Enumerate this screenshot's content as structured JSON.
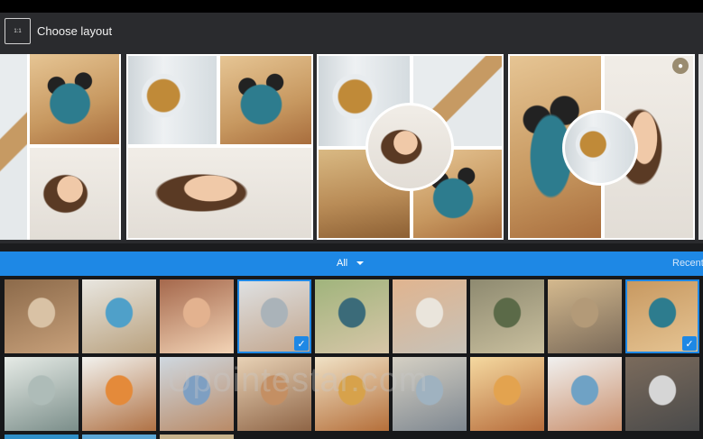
{
  "header": {
    "ratio_label": "1:1",
    "title": "Choose layout"
  },
  "layouts": [
    {
      "name": "layout-1",
      "locked": false
    },
    {
      "name": "layout-2",
      "locked": false
    },
    {
      "name": "layout-3",
      "locked": false
    },
    {
      "name": "layout-4",
      "locked": true
    }
  ],
  "tabs": {
    "current": "All",
    "right": "Recent"
  },
  "gallery": {
    "row1": [
      {
        "name": "photo-legs-street",
        "selected": false
      },
      {
        "name": "photo-man-dog",
        "selected": false
      },
      {
        "name": "photo-couple-heart",
        "selected": false
      },
      {
        "name": "photo-girl-glasses",
        "selected": true
      },
      {
        "name": "photo-woman-laughing",
        "selected": false
      },
      {
        "name": "photo-woman-beach",
        "selected": false
      },
      {
        "name": "photo-tree-guitar",
        "selected": false
      },
      {
        "name": "photo-balloon",
        "selected": false
      },
      {
        "name": "photo-shoe-sunglasses",
        "selected": true
      }
    ],
    "row2": [
      {
        "name": "photo-woman-car",
        "selected": false
      },
      {
        "name": "photo-orange-dress",
        "selected": false
      },
      {
        "name": "photo-jumping",
        "selected": false
      },
      {
        "name": "photo-woman-tattoo",
        "selected": false
      },
      {
        "name": "photo-food-plate",
        "selected": false
      },
      {
        "name": "photo-paris",
        "selected": false
      },
      {
        "name": "photo-sunset-path",
        "selected": false
      },
      {
        "name": "photo-couple-hats",
        "selected": false
      },
      {
        "name": "photo-sneakers",
        "selected": false
      }
    ],
    "check_glyph": "✓"
  },
  "watermark": "Upointestar.com",
  "colors": {
    "accent": "#1e88e5",
    "header_bg": "#2a2b2e",
    "gallery_bg": "#17181a"
  }
}
